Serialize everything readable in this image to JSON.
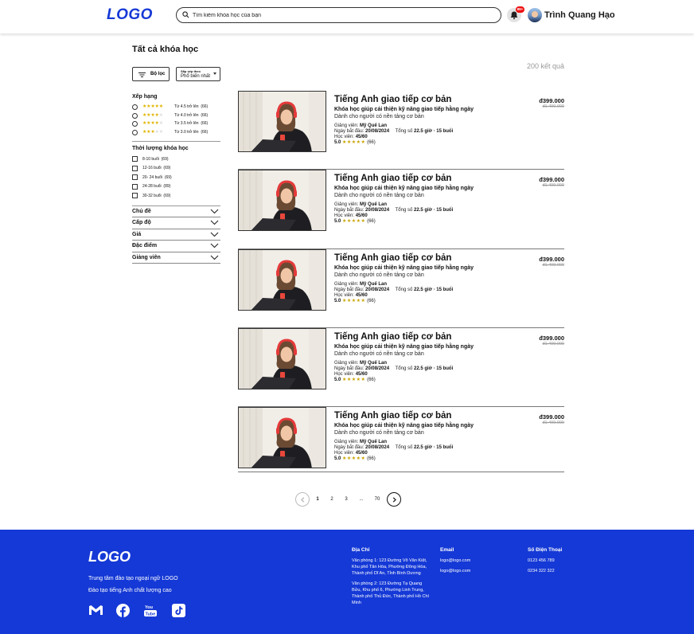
{
  "header": {
    "logo": "LOGO",
    "search_placeholder": "Tìm kiếm khóa học của bạn",
    "notification_badge": "99+",
    "user_name": "Trình Quang Hạo"
  },
  "main": {
    "title": "Tất cả khóa học",
    "results": "200 kết quả",
    "filter_button": "Bộ lọc",
    "sort_caption": "Sắp xếp theo",
    "sort_value": "Phổ biến nhất"
  },
  "sidebar": {
    "rating_title": "Xếp hạng",
    "ratings": [
      {
        "stars": "★★★★★",
        "stars_off": "",
        "label": "Từ 4.5 trở lên",
        "count": "(66)"
      },
      {
        "stars": "★★★★",
        "stars_off": "★",
        "label": "Từ 4.0 trở lên",
        "count": "(66)"
      },
      {
        "stars": "★★★★",
        "stars_off": "★",
        "label": "Từ 3.5 trở lên",
        "count": "(66)"
      },
      {
        "stars": "★★★",
        "stars_off": "★★",
        "label": "Từ 3.0 trở lên",
        "count": "(66)"
      }
    ],
    "duration_title": "Thời lượng khóa học",
    "durations": [
      {
        "label": "8-10 buổi",
        "count": "(69)"
      },
      {
        "label": "12-16 buổi",
        "count": "(69)"
      },
      {
        "label": "20- 24 buổi",
        "count": "(69)"
      },
      {
        "label": "24-28 buổi",
        "count": "(89)"
      },
      {
        "label": "30-32 buổi",
        "count": "(69)"
      }
    ],
    "accordions": [
      "Chủ đề",
      "Cấp độ",
      "Giá",
      "Đặc điểm",
      "Giảng viên"
    ]
  },
  "courses": [
    {
      "title": "Tiếng Anh giao tiếp cơ bản",
      "subtitle": "Khóa học giúp cải thiện kỹ năng giao tiếp hằng ngày",
      "audience": "Dành cho người có nền tảng cơ bản",
      "teacher_label": "Giảng viên:",
      "teacher": "Mỹ Quế Lan",
      "start_label": "Ngày bắt đầu:",
      "start": "20/08/2024",
      "total_label": "Tổng số",
      "total": "22.5 giờ · 15 buổi",
      "students_label": "Học viên:",
      "students": "45/60",
      "rating": "5.0",
      "stars": "★★★★★",
      "reviews": "(66)",
      "price": "đ399.000",
      "old_price": "đ1.499.000"
    },
    {
      "title": "Tiếng Anh giao tiếp cơ bản",
      "subtitle": "Khóa học giúp cải thiện kỹ năng giao tiếp hằng ngày",
      "audience": "Dành cho người có nền tảng cơ bản",
      "teacher_label": "Giảng viên:",
      "teacher": "Mỹ Quế Lan",
      "start_label": "Ngày bắt đầu:",
      "start": "20/08/2024",
      "total_label": "Tổng số",
      "total": "22.5 giờ · 15 buổi",
      "students_label": "Học viên:",
      "students": "45/60",
      "rating": "5.0",
      "stars": "★★★★★",
      "reviews": "(66)",
      "price": "đ399.000",
      "old_price": "đ1.499.000"
    },
    {
      "title": "Tiếng Anh giao tiếp cơ bản",
      "subtitle": "Khóa học giúp cải thiện kỹ năng giao tiếp hằng ngày",
      "audience": "Dành cho người có nền tảng cơ bản",
      "teacher_label": "Giảng viên:",
      "teacher": "Mỹ Quế Lan",
      "start_label": "Ngày bắt đầu:",
      "start": "20/08/2024",
      "total_label": "Tổng số",
      "total": "22.5 giờ · 15 buổi",
      "students_label": "Học viên:",
      "students": "45/60",
      "rating": "5.0",
      "stars": "★★★★★",
      "reviews": "(66)",
      "price": "đ399.000",
      "old_price": "đ1.499.000"
    },
    {
      "title": "Tiếng Anh giao tiếp cơ bản",
      "subtitle": "Khóa học giúp cải thiện kỹ năng giao tiếp hằng ngày",
      "audience": "Dành cho người có nền tảng cơ bản",
      "teacher_label": "Giảng viên:",
      "teacher": "Mỹ Quế Lan",
      "start_label": "Ngày bắt đầu:",
      "start": "20/08/2024",
      "total_label": "Tổng số",
      "total": "22.5 giờ · 15 buổi",
      "students_label": "Học viên:",
      "students": "45/60",
      "rating": "5.0",
      "stars": "★★★★★",
      "reviews": "(66)",
      "price": "đ399.000",
      "old_price": "đ1.499.000"
    },
    {
      "title": "Tiếng Anh giao tiếp cơ bản",
      "subtitle": "Khóa học giúp cải thiện kỹ năng giao tiếp hằng ngày",
      "audience": "Dành cho người có nền tảng cơ bản",
      "teacher_label": "Giảng viên:",
      "teacher": "Mỹ Quế Lan",
      "start_label": "Ngày bắt đầu:",
      "start": "20/08/2024",
      "total_label": "Tổng số",
      "total": "22.5 giờ · 15 buổi",
      "students_label": "Học viên:",
      "students": "45/60",
      "rating": "5.0",
      "stars": "★★★★★",
      "reviews": "(66)",
      "price": "đ399.000",
      "old_price": "đ1.499.000"
    }
  ],
  "pagination": {
    "pages": [
      "1",
      "2",
      "3",
      "...",
      "70"
    ]
  },
  "footer": {
    "logo": "LOGO",
    "line1": "Trung tâm đào tạo ngoại ngữ LOGO",
    "line2": "Đào tạo tiếng Anh chất lượng cao",
    "address_title": "Địa Chỉ",
    "address_1": "Văn phòng 1: 123 Đường Võ Văn Kiệt, Khu phố Tân Hòa, Phường Đông Hòa, Thành phố Dĩ An, Tỉnh Bình Dương",
    "address_2": "Văn phòng 2: 123 Đường Tạ Quang Bửu, Khu phố 6, Phường Linh Trung, Thành phố Thủ Đức, Thành phố Hồ Chí Minh",
    "email_title": "Email",
    "email_1": "logo@logo.com",
    "email_2": "logo@logo.com",
    "phone_title": "Số Điện Thoại",
    "phone_1": "0123 456 789",
    "phone_2": "0234 322 322"
  },
  "colors": {
    "brand": "#1539d6",
    "star": "#e0b400",
    "badge": "#ee1111"
  }
}
